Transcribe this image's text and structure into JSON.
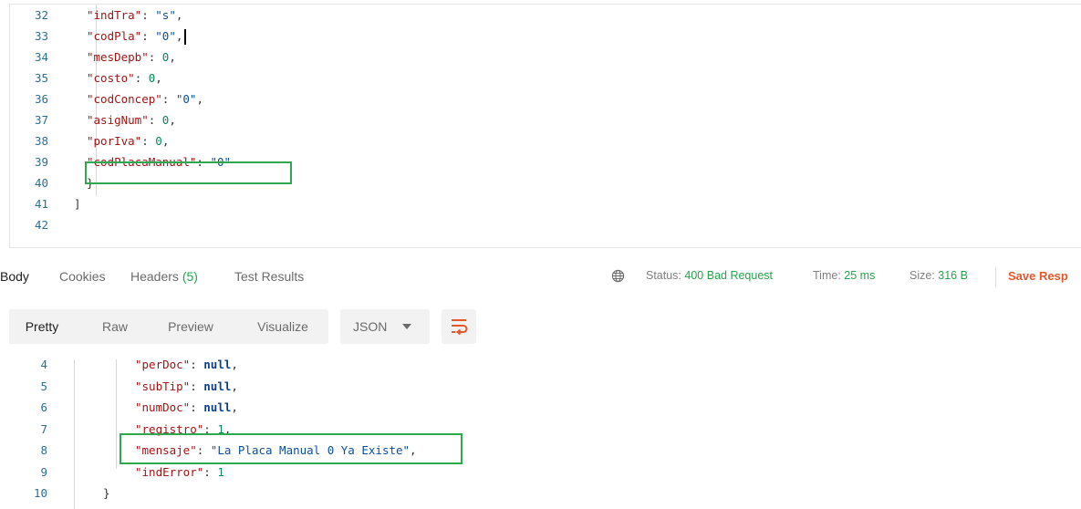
{
  "request_editor": {
    "lines": [
      {
        "num": "32",
        "key": "\"indTra\"",
        "colon": ": ",
        "value": "\"s\"",
        "value_type": "string",
        "tail": ","
      },
      {
        "num": "33",
        "key": "\"codPla\"",
        "colon": ": ",
        "value": "\"0\"",
        "value_type": "string",
        "tail": ","
      },
      {
        "num": "34",
        "key": "\"mesDepb\"",
        "colon": ": ",
        "value": "0",
        "value_type": "number",
        "tail": ","
      },
      {
        "num": "35",
        "key": "\"costo\"",
        "colon": ": ",
        "value": "0",
        "value_type": "number",
        "tail": ","
      },
      {
        "num": "36",
        "key": "\"codConcep\"",
        "colon": ": ",
        "value": "\"0\"",
        "value_type": "string",
        "tail": ","
      },
      {
        "num": "37",
        "key": "\"asigNum\"",
        "colon": ": ",
        "value": "0",
        "value_type": "number",
        "tail": ","
      },
      {
        "num": "38",
        "key": "\"porIva\"",
        "colon": ": ",
        "value": "0",
        "value_type": "number",
        "tail": ","
      },
      {
        "num": "39",
        "key": "\"codPlacaManual\"",
        "colon": ": ",
        "value": "\"0\"",
        "value_type": "string",
        "tail": ""
      },
      {
        "num": "40",
        "key": "}",
        "colon": "",
        "value": "",
        "value_type": "punct",
        "tail": ""
      },
      {
        "num": "41",
        "key": "]",
        "colon": "",
        "value": "",
        "value_type": "punct",
        "tail": ""
      },
      {
        "num": "42",
        "key": "",
        "colon": "",
        "value": "",
        "value_type": "punct",
        "tail": ""
      }
    ]
  },
  "response_tabs": {
    "body": "Body",
    "cookies": "Cookies",
    "headers_label": "Headers",
    "headers_count": "(5)",
    "test_results": "Test Results"
  },
  "response_status": {
    "status_label": "Status:",
    "status_value": "400 Bad Request",
    "time_label": "Time:",
    "time_value": "25 ms",
    "size_label": "Size:",
    "size_value": "316 B",
    "save_label": "Save Resp"
  },
  "view_toolbar": {
    "pretty": "Pretty",
    "raw": "Raw",
    "preview": "Preview",
    "visualize": "Visualize",
    "format": "JSON",
    "wrap_icon": "wrap-lines-icon"
  },
  "response_body": {
    "lines": [
      {
        "num": "4",
        "key": "\"perDoc\"",
        "colon": ": ",
        "value": "null",
        "value_type": "null",
        "tail": ","
      },
      {
        "num": "5",
        "key": "\"subTip\"",
        "colon": ": ",
        "value": "null",
        "value_type": "null",
        "tail": ","
      },
      {
        "num": "6",
        "key": "\"numDoc\"",
        "colon": ": ",
        "value": "null",
        "value_type": "null",
        "tail": ","
      },
      {
        "num": "7",
        "key": "\"registro\"",
        "colon": ": ",
        "value": "1",
        "value_type": "number",
        "tail": ","
      },
      {
        "num": "8",
        "key": "\"mensaje\"",
        "colon": ": ",
        "value": "\"La Placa Manual 0 Ya Existe\"",
        "value_type": "string",
        "tail": ","
      },
      {
        "num": "9",
        "key": "\"indError\"",
        "colon": ": ",
        "value": "1",
        "value_type": "number",
        "tail": ""
      },
      {
        "num": "10",
        "key": "}",
        "colon": "",
        "value": "",
        "value_type": "punct",
        "tail": ""
      }
    ]
  },
  "colors": {
    "highlight_box": "#2fa84f",
    "status_ok_text": "#26a34a",
    "save_accent": "#e8562a",
    "line_number": "#2a6f94"
  }
}
